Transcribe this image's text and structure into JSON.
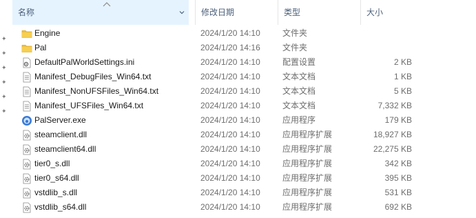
{
  "columns": {
    "name": "名称",
    "date": "修改日期",
    "type": "类型",
    "size": "大小"
  },
  "files": [
    {
      "name": "Engine",
      "date": "2024/1/20 14:10",
      "type": "文件夹",
      "size": "",
      "icon": "folder-icon"
    },
    {
      "name": "Pal",
      "date": "2024/1/20 14:16",
      "type": "文件夹",
      "size": "",
      "icon": "folder-icon"
    },
    {
      "name": "DefaultPalWorldSettings.ini",
      "date": "2024/1/20 14:10",
      "type": "配置设置",
      "size": "2 KB",
      "icon": "settings-file-icon"
    },
    {
      "name": "Manifest_DebugFiles_Win64.txt",
      "date": "2024/1/20 14:10",
      "type": "文本文档",
      "size": "1 KB",
      "icon": "text-file-icon"
    },
    {
      "name": "Manifest_NonUFSFiles_Win64.txt",
      "date": "2024/1/20 14:10",
      "type": "文本文档",
      "size": "5 KB",
      "icon": "text-file-icon"
    },
    {
      "name": "Manifest_UFSFiles_Win64.txt",
      "date": "2024/1/20 14:10",
      "type": "文本文档",
      "size": "7,332 KB",
      "icon": "text-file-icon"
    },
    {
      "name": "PalServer.exe",
      "date": "2024/1/20 14:10",
      "type": "应用程序",
      "size": "179 KB",
      "icon": "app-exe-icon"
    },
    {
      "name": "steamclient.dll",
      "date": "2024/1/20 14:10",
      "type": "应用程序扩展",
      "size": "18,927 KB",
      "icon": "dll-file-icon"
    },
    {
      "name": "steamclient64.dll",
      "date": "2024/1/20 14:10",
      "type": "应用程序扩展",
      "size": "22,275 KB",
      "icon": "dll-file-icon"
    },
    {
      "name": "tier0_s.dll",
      "date": "2024/1/20 14:10",
      "type": "应用程序扩展",
      "size": "342 KB",
      "icon": "dll-file-icon"
    },
    {
      "name": "tier0_s64.dll",
      "date": "2024/1/20 14:10",
      "type": "应用程序扩展",
      "size": "395 KB",
      "icon": "dll-file-icon"
    },
    {
      "name": "vstdlib_s.dll",
      "date": "2024/1/20 14:10",
      "type": "应用程序扩展",
      "size": "531 KB",
      "icon": "dll-file-icon"
    },
    {
      "name": "vstdlib_s64.dll",
      "date": "2024/1/20 14:10",
      "type": "应用程序扩展",
      "size": "692 KB",
      "icon": "dll-file-icon"
    }
  ]
}
